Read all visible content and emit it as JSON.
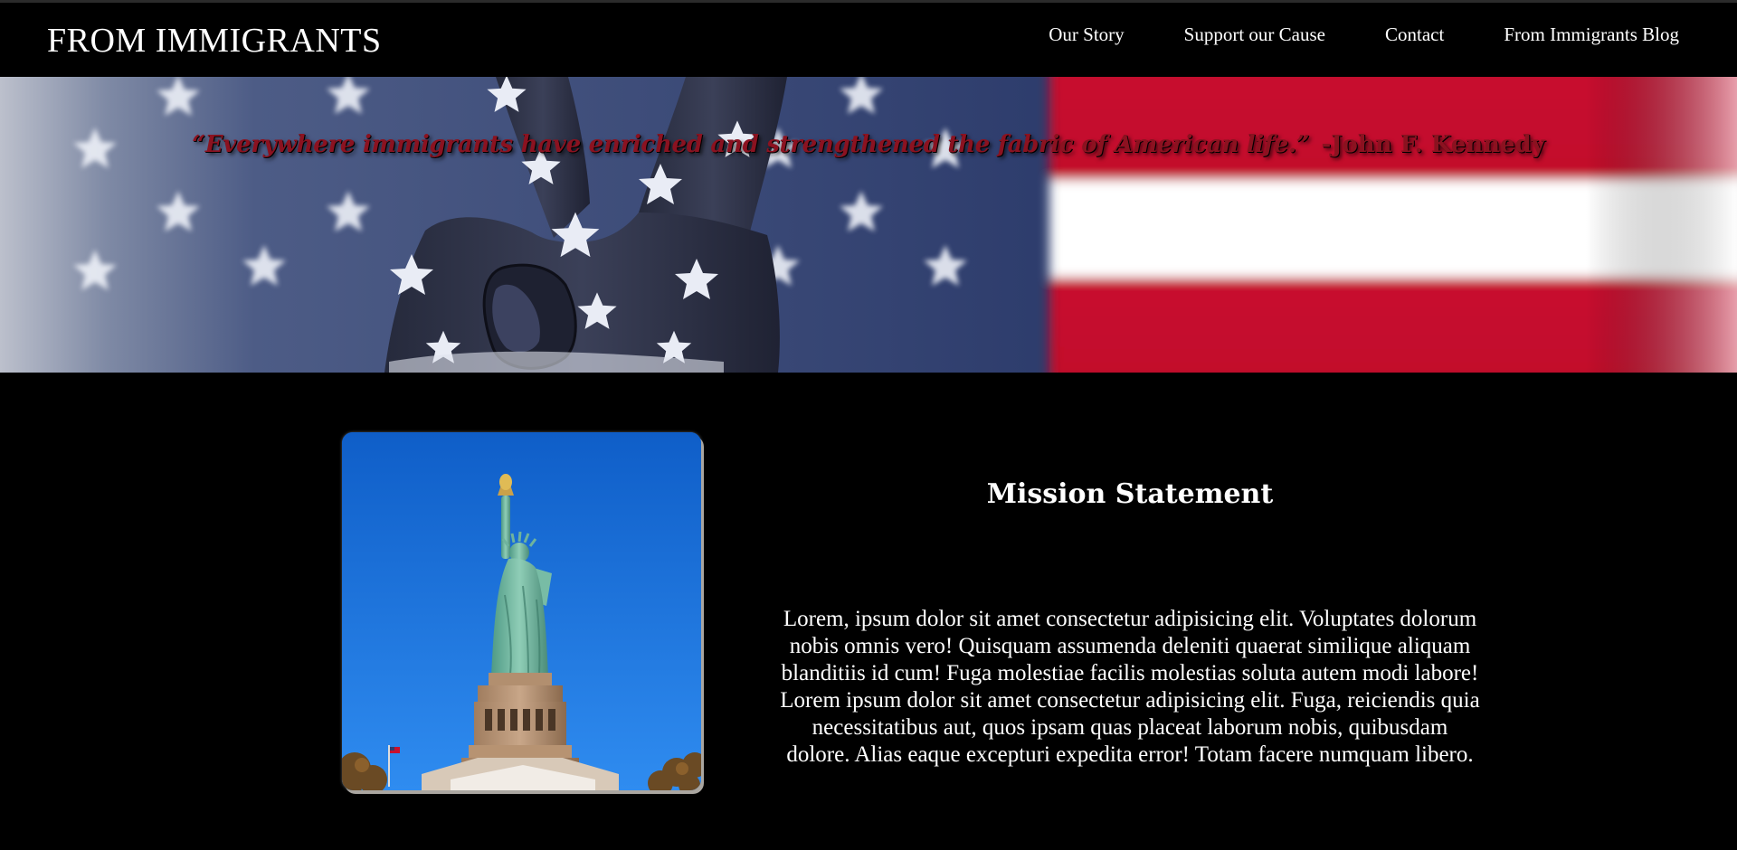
{
  "header": {
    "brand": "FROM IMMIGRANTS",
    "nav": [
      {
        "label": "Our Story"
      },
      {
        "label": "Support our Cause"
      },
      {
        "label": "Contact"
      },
      {
        "label": "From Immigrants Blog"
      }
    ]
  },
  "hero": {
    "quote": "“Everywhere immigrants have enriched and strengthened the fabric of American life.”",
    "author": "-John F. Kennedy"
  },
  "mission": {
    "title": "Mission Statement",
    "body": "Lorem, ipsum dolor sit amet consectetur adipisicing elit. Voluptates dolorum nobis omnis vero! Quisquam assumenda deleniti quaerat similique aliquam blanditiis id cum! Fuga molestiae facilis molestias soluta autem modi labore! Lorem ipsum dolor sit amet consectetur adipisicing elit. Fuga, reiciendis quia necessitatibus aut, quos ipsam quas placeat laborum nobis, quibusdam dolore. Alias eaque excepturi expedita error! Totam facere numquam libero."
  },
  "colors": {
    "page_background": "#000000",
    "text": "#ffffff",
    "quote_color": "#8b1220",
    "flag_blue": "#2f3d6e",
    "flag_red": "#c8102e",
    "sky_blue": "#1a6fd8"
  },
  "images": {
    "hero_banner": "hand-flag-peace-sign",
    "mission_photo": "statue-of-liberty"
  }
}
